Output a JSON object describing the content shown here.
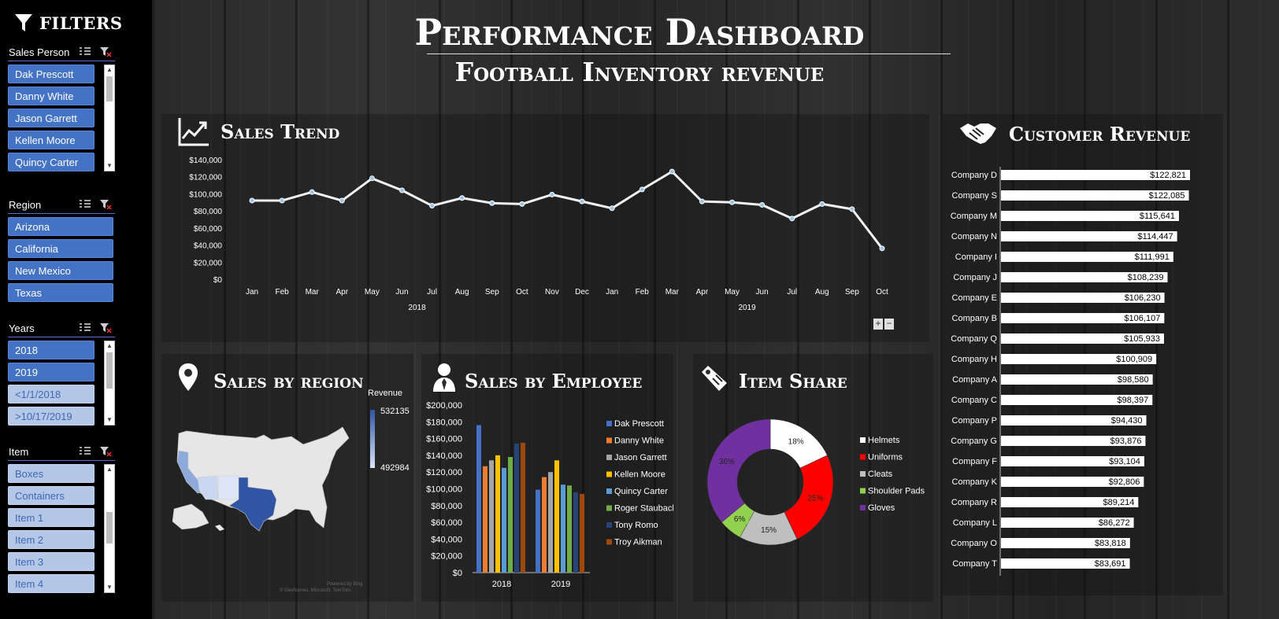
{
  "header": {
    "title": "Performance Dashboard",
    "subtitle": "Football Inventory revenue"
  },
  "filters": {
    "title": "FILTERS",
    "slicers": {
      "sales_person": {
        "label": "Sales Person",
        "items": [
          {
            "label": "Dak Prescott",
            "selected": true
          },
          {
            "label": "Danny White",
            "selected": true
          },
          {
            "label": "Jason Garrett",
            "selected": true
          },
          {
            "label": "Kellen Moore",
            "selected": true
          },
          {
            "label": "Quincy Carter",
            "selected": true
          }
        ]
      },
      "region": {
        "label": "Region",
        "items": [
          {
            "label": "Arizona",
            "selected": true
          },
          {
            "label": "California",
            "selected": true
          },
          {
            "label": "New Mexico",
            "selected": true
          },
          {
            "label": "Texas",
            "selected": true
          }
        ]
      },
      "years": {
        "label": "Years",
        "items": [
          {
            "label": "2018",
            "selected": true
          },
          {
            "label": "2019",
            "selected": true
          },
          {
            "label": "<1/1/2018",
            "selected": false
          },
          {
            "label": ">10/17/2019",
            "selected": false
          }
        ]
      },
      "item": {
        "label": "Item",
        "items": [
          {
            "label": "Boxes",
            "selected": false
          },
          {
            "label": "Containers",
            "selected": false
          },
          {
            "label": "Item 1",
            "selected": false
          },
          {
            "label": "Item 2",
            "selected": false
          },
          {
            "label": "Item 3",
            "selected": false
          },
          {
            "label": "Item 4",
            "selected": false
          }
        ]
      }
    }
  },
  "sections": {
    "sales_trend": "Sales Trend",
    "customer_revenue": "Customer Revenue",
    "sales_by_region": "Sales by region",
    "sales_by_employee": "Sales by Employee",
    "item_share": "Item Share"
  },
  "map": {
    "legend_title": "Revenue",
    "legend_max": "532135",
    "legend_min": "492984",
    "credit_1": "Powered by Bing",
    "credit_2": "© GeoNames, Microsoft, TomTom"
  },
  "colors": {
    "accent": "#4472c4",
    "helmets": "#ffffff",
    "uniforms": "#ff0000",
    "cleats": "#bfbfbf",
    "shoulder_pads": "#92d050",
    "gloves": "#7030a0"
  },
  "chart_data": [
    {
      "id": "sales_trend",
      "type": "line",
      "x": [
        "Jan",
        "Feb",
        "Mar",
        "Apr",
        "May",
        "Jun",
        "Jul",
        "Aug",
        "Sep",
        "Oct",
        "Nov",
        "Dec",
        "Jan",
        "Feb",
        "Mar",
        "Apr",
        "May",
        "Jun",
        "Jul",
        "Aug",
        "Sep",
        "Oct"
      ],
      "year_groups": [
        {
          "label": "2018",
          "months": 12
        },
        {
          "label": "2019",
          "months": 10
        }
      ],
      "series": [
        {
          "values": [
            93000,
            93000,
            103000,
            93000,
            119000,
            105000,
            87000,
            96000,
            90000,
            89000,
            100000,
            92000,
            84000,
            106000,
            127000,
            92000,
            91000,
            88000,
            72000,
            89000,
            83000,
            37000
          ]
        }
      ],
      "y_ticks": [
        "$0",
        "$20,000",
        "$40,000",
        "$60,000",
        "$80,000",
        "$100,000",
        "$120,000",
        "$140,000"
      ],
      "ylim": [
        0,
        140000
      ]
    },
    {
      "id": "sales_by_employee",
      "type": "bar",
      "categories": [
        "2018",
        "2019"
      ],
      "series": [
        {
          "name": "Dak Prescott",
          "color": "#4472c4",
          "values": [
            176000,
            99000
          ]
        },
        {
          "name": "Danny White",
          "color": "#ed7d31",
          "values": [
            127000,
            114000
          ]
        },
        {
          "name": "Jason Garrett",
          "color": "#a5a5a5",
          "values": [
            134000,
            120000
          ]
        },
        {
          "name": "Kellen Moore",
          "color": "#ffc000",
          "values": [
            140000,
            134000
          ]
        },
        {
          "name": "Quincy Carter",
          "color": "#5b9bd5",
          "values": [
            125000,
            105000
          ]
        },
        {
          "name": "Roger Staubach",
          "color": "#70ad47",
          "values": [
            138000,
            104000
          ]
        },
        {
          "name": "Tony Romo",
          "color": "#264478",
          "values": [
            154000,
            96000
          ]
        },
        {
          "name": "Troy Aikman",
          "color": "#9e480e",
          "values": [
            155000,
            94000
          ]
        }
      ],
      "y_ticks": [
        "$0",
        "$20,000",
        "$40,000",
        "$60,000",
        "$80,000",
        "$100,000",
        "$120,000",
        "$140,000",
        "$160,000",
        "$180,000",
        "$200,000"
      ],
      "ylim": [
        0,
        200000
      ]
    },
    {
      "id": "item_share",
      "type": "pie",
      "labels": [
        "Helmets",
        "Uniforms",
        "Cleats",
        "Shoulder Pads",
        "Gloves"
      ],
      "values": [
        18,
        25,
        15,
        6,
        36
      ],
      "display": [
        "18%",
        "25%",
        "15%",
        "6%",
        "36%"
      ],
      "colors": [
        "#ffffff",
        "#ff0000",
        "#bfbfbf",
        "#92d050",
        "#7030a0"
      ]
    },
    {
      "id": "customer_revenue",
      "type": "bar",
      "categories": [
        "Company D",
        "Company S",
        "Company M",
        "Company N",
        "Company I",
        "Company J",
        "Company E",
        "Company B",
        "Company Q",
        "Company H",
        "Company A",
        "Company C",
        "Company P",
        "Company G",
        "Company F",
        "Company K",
        "Company R",
        "Company L",
        "Company O",
        "Company T"
      ],
      "values": [
        122821,
        122085,
        115641,
        114447,
        111991,
        108239,
        106230,
        106107,
        105933,
        100909,
        98580,
        98397,
        94430,
        93876,
        93104,
        92806,
        89214,
        86272,
        83818,
        83691
      ],
      "display": [
        "$122,821",
        "$122,085",
        "$115,641",
        "$114,447",
        "$111,991",
        "$108,239",
        "$106,230",
        "$106,107",
        "$105,933",
        "$100,909",
        "$98,580",
        "$98,397",
        "$94,430",
        "$93,876",
        "$93,104",
        "$92,806",
        "$89,214",
        "$86,272",
        "$83,818",
        "$83,691"
      ]
    }
  ]
}
